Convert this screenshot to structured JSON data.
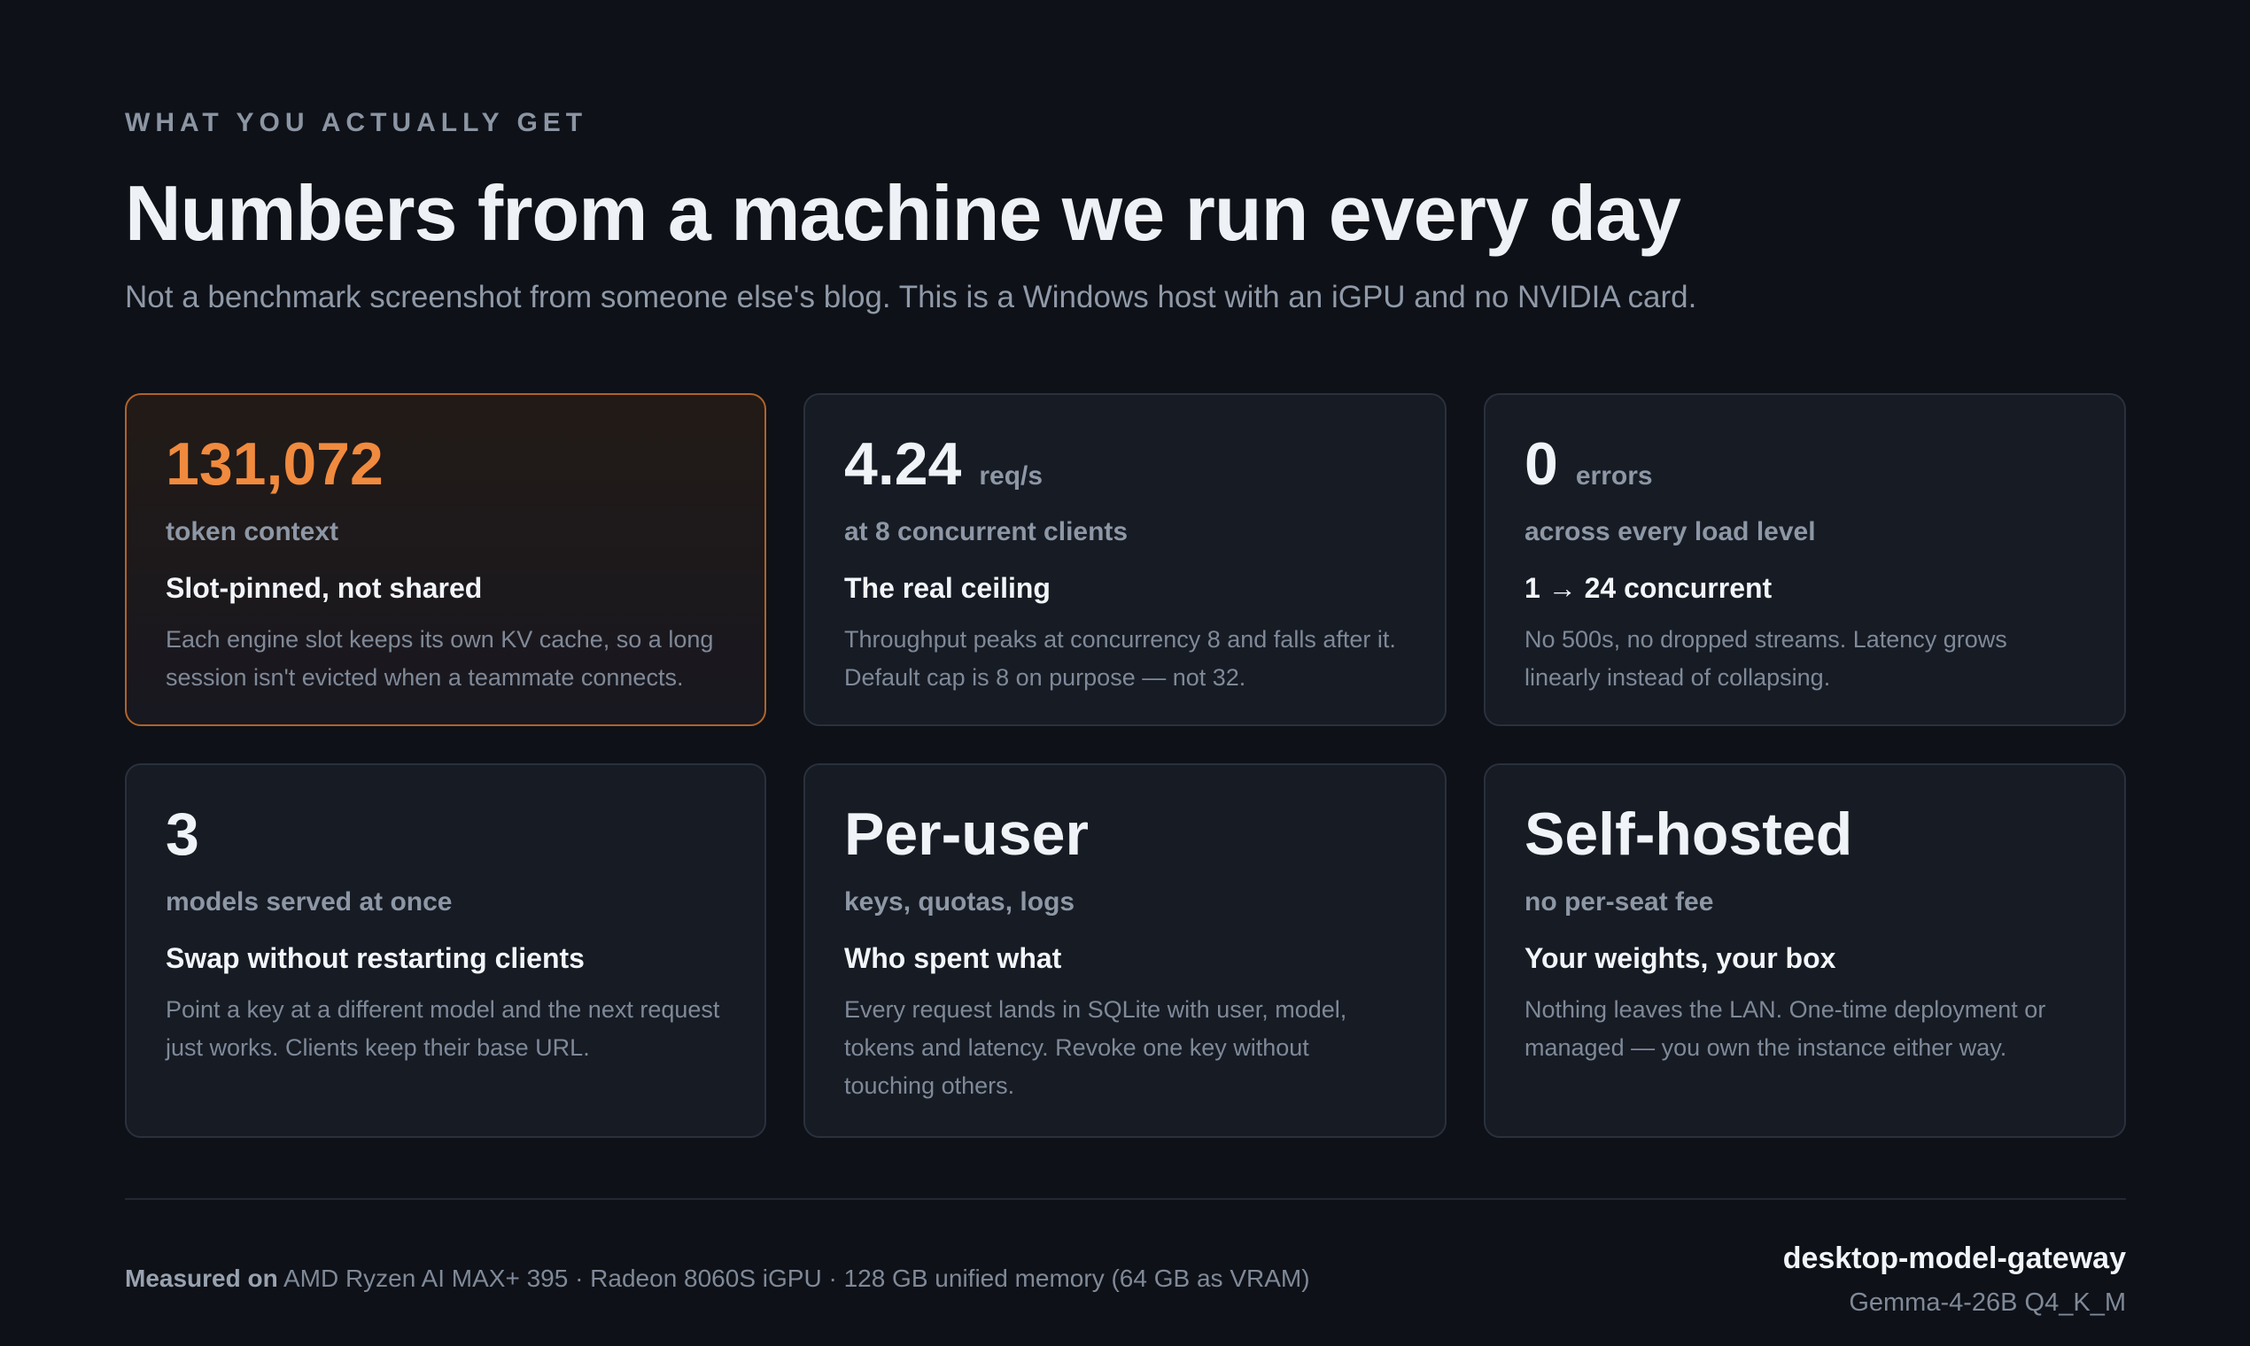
{
  "header": {
    "eyebrow": "WHAT YOU ACTUALLY GET",
    "title": "Numbers from a machine we run every day",
    "subtitle": "Not a benchmark screenshot from someone else's blog. This is a Windows host with an iGPU and no NVIDIA card."
  },
  "cards": [
    {
      "stat": "131,072",
      "unit": "",
      "sub": "token context",
      "heading": "Slot-pinned, not shared",
      "body": "Each engine slot keeps its own KV cache, so a long session isn't evicted when a teammate connects."
    },
    {
      "stat": "4.24",
      "unit": "req/s",
      "sub": "at 8 concurrent clients",
      "heading": "The real ceiling",
      "body": "Throughput peaks at concurrency 8 and falls after it. Default cap is 8 on purpose — not 32."
    },
    {
      "stat": "0",
      "unit": "errors",
      "sub": "across every load level",
      "heading": "1 → 24 concurrent",
      "body": "No 500s, no dropped streams. Latency grows linearly instead of collapsing."
    },
    {
      "stat": "3",
      "unit": "",
      "sub": "models served at once",
      "heading": "Swap without restarting clients",
      "body": "Point a key at a different model and the next request just works. Clients keep their base URL."
    },
    {
      "stat": "Per-user",
      "unit": "",
      "sub": "keys, quotas, logs",
      "heading": "Who spent what",
      "body": "Every request lands in SQLite with user, model, tokens and latency. Revoke one key without touching others."
    },
    {
      "stat": "Self-hosted",
      "unit": "",
      "sub": "no per-seat fee",
      "heading": "Your weights, your box",
      "body": "Nothing leaves the LAN. One-time deployment or managed — you own the instance either way."
    }
  ],
  "footer": {
    "measured_label": "Measured on",
    "measured_value": "AMD Ryzen AI MAX+ 395 · Radeon 8060S iGPU · 128 GB unified memory (64 GB as VRAM)",
    "product": "desktop-model-gateway",
    "model": "Gemma-4-26B Q4_K_M"
  },
  "colors": {
    "background": "#0e1117",
    "card": "#161b24",
    "accent": "#f08a3e",
    "accent_border": "#b0632a"
  }
}
